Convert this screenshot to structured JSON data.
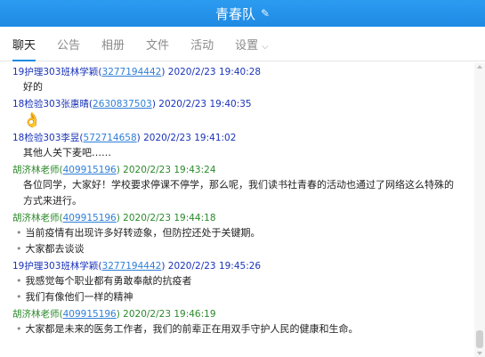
{
  "title": "青春队",
  "tabs": [
    {
      "label": "聊天",
      "active": true
    },
    {
      "label": "公告"
    },
    {
      "label": "相册"
    },
    {
      "label": "文件"
    },
    {
      "label": "活动"
    },
    {
      "label": "设置"
    }
  ],
  "messages": [
    {
      "sender": "19护理303班林学颖",
      "qq": "3277194442",
      "time": "2020/2/23 19:40:28",
      "lines": [
        "好的"
      ]
    },
    {
      "sender": "18检验303张惠晴",
      "qq": "2630837503",
      "time": "2020/2/23 19:40:35",
      "emoji": "👌"
    },
    {
      "sender": "18检验303李昱",
      "qq": "572714658",
      "time": "2020/2/23 19:41:02",
      "lines": [
        "其他人关下麦吧……"
      ]
    },
    {
      "sender": "胡济林老师",
      "qq": "409915196",
      "time": "2020/2/23 19:43:24",
      "lines": [
        "各位同学，大家好！学校要求停课不停学，那么呢，我们读书社青春的活动也通过了网络这么特殊的方式来进行。"
      ]
    },
    {
      "sender": "胡济林老师",
      "qq": "409915196",
      "time": "2020/2/23 19:44:18",
      "lines": [
        "当前疫情有出现许多好转迹象，但防控还处于关键期。",
        "大家都去谈谈"
      ]
    },
    {
      "sender": "19护理303班林学颖",
      "qq": "3277194442",
      "time": "2020/2/23 19:45:26",
      "lines": [
        "我感觉每个职业都有勇敢奉献的抗疫者",
        "我们有像他们一样的精神"
      ]
    },
    {
      "sender": "胡济林老师",
      "qq": "409915196",
      "time": "2020/2/23 19:46:19",
      "lines": [
        "大家都是未来的医务工作者，我们的前辈正在用双手守护人民的健康和生命。"
      ]
    }
  ],
  "colors": {
    "header": "#1f8ae3",
    "sender_blue": "#1a33b8",
    "sender_green": "#2c8a2c",
    "qq_link": "#2f7fd6"
  }
}
